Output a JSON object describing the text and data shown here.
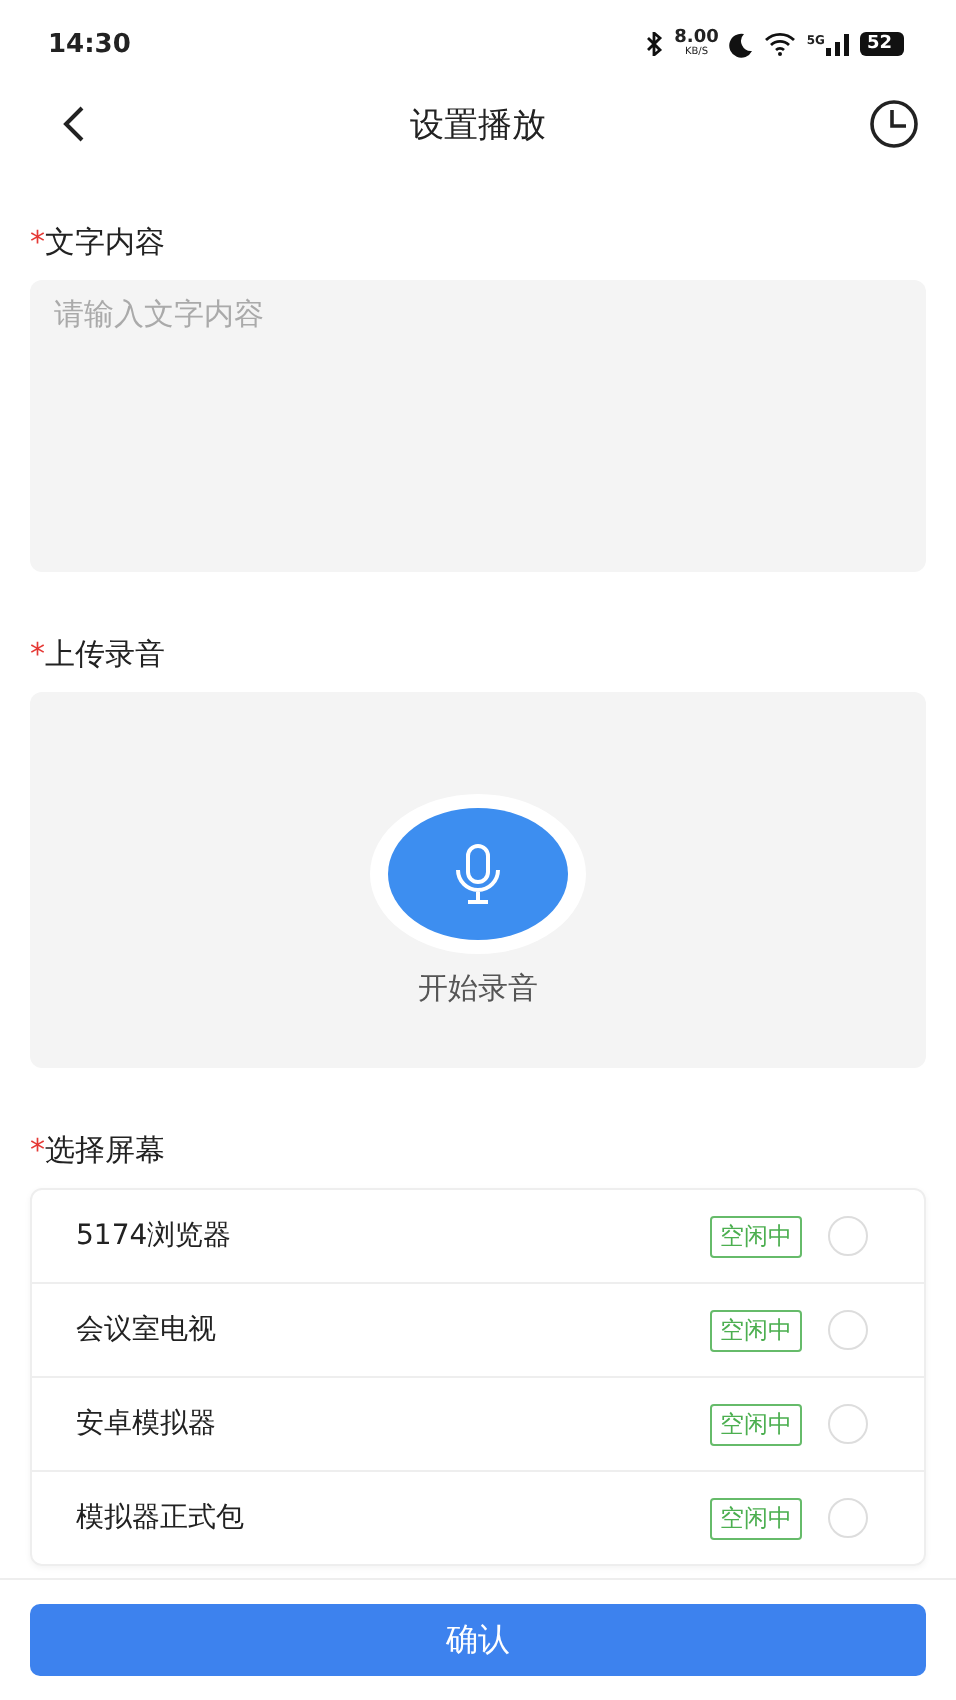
{
  "status_bar": {
    "time": "14:30",
    "speed_value": "8.00",
    "speed_unit": "KB/S",
    "network": "5G",
    "battery": "52"
  },
  "header": {
    "title": "设置播放"
  },
  "text_section": {
    "mark": "*",
    "label": "文字内容",
    "placeholder": "请输入文字内容"
  },
  "record_section": {
    "mark": "*",
    "label": "上传录音",
    "button_label": "开始录音"
  },
  "screen_section": {
    "mark": "*",
    "label": "选择屏幕"
  },
  "screens": [
    {
      "name": "5174浏览器",
      "status": "空闲中",
      "selected": false
    },
    {
      "name": "会议室电视",
      "status": "空闲中",
      "selected": false
    },
    {
      "name": "安卓模拟器",
      "status": "空闲中",
      "selected": false
    },
    {
      "name": "模拟器正式包",
      "status": "空闲中",
      "selected": false
    }
  ],
  "confirm_button": "确认"
}
